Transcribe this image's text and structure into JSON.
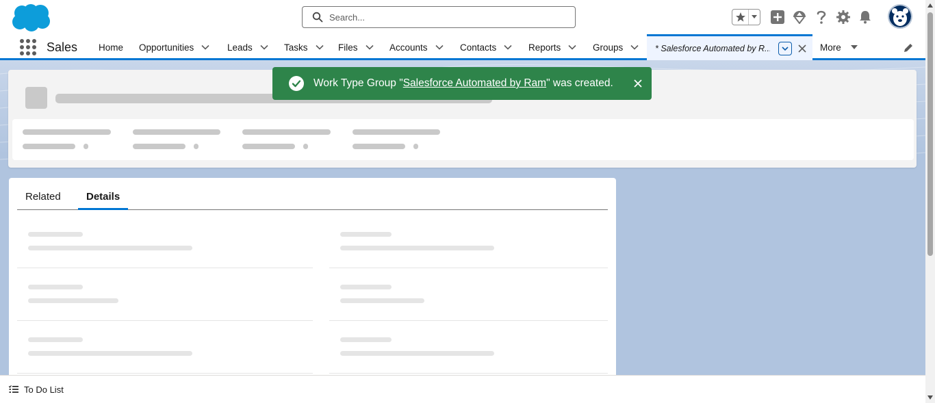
{
  "header": {
    "search_placeholder": "Search...",
    "icons": [
      "favorites-star-icon",
      "favorites-dropdown-icon",
      "global-create-icon",
      "trailhead-icon",
      "help-icon",
      "setup-gear-icon",
      "notifications-bell-icon",
      "user-avatar"
    ]
  },
  "nav": {
    "app_name": "Sales",
    "items": [
      {
        "label": "Home",
        "has_menu": false
      },
      {
        "label": "Opportunities",
        "has_menu": true
      },
      {
        "label": "Leads",
        "has_menu": true
      },
      {
        "label": "Tasks",
        "has_menu": true
      },
      {
        "label": "Files",
        "has_menu": true
      },
      {
        "label": "Accounts",
        "has_menu": true
      },
      {
        "label": "Contacts",
        "has_menu": true
      },
      {
        "label": "Reports",
        "has_menu": true
      },
      {
        "label": "Groups",
        "has_menu": true
      }
    ],
    "active_tab": "* Salesforce Automated by R...",
    "more_label": "More"
  },
  "toast": {
    "prefix": "Work Type Group \"",
    "link_text": "Salesforce Automated by Ram",
    "suffix": "\" was created.",
    "status_color": "#2e844a"
  },
  "detail_tabs": {
    "related": "Related",
    "details": "Details"
  },
  "utility": {
    "todo_label": "To Do List"
  },
  "colors": {
    "brand": "#0176d3",
    "success": "#2e844a",
    "page_bg": "#b0c4df"
  }
}
